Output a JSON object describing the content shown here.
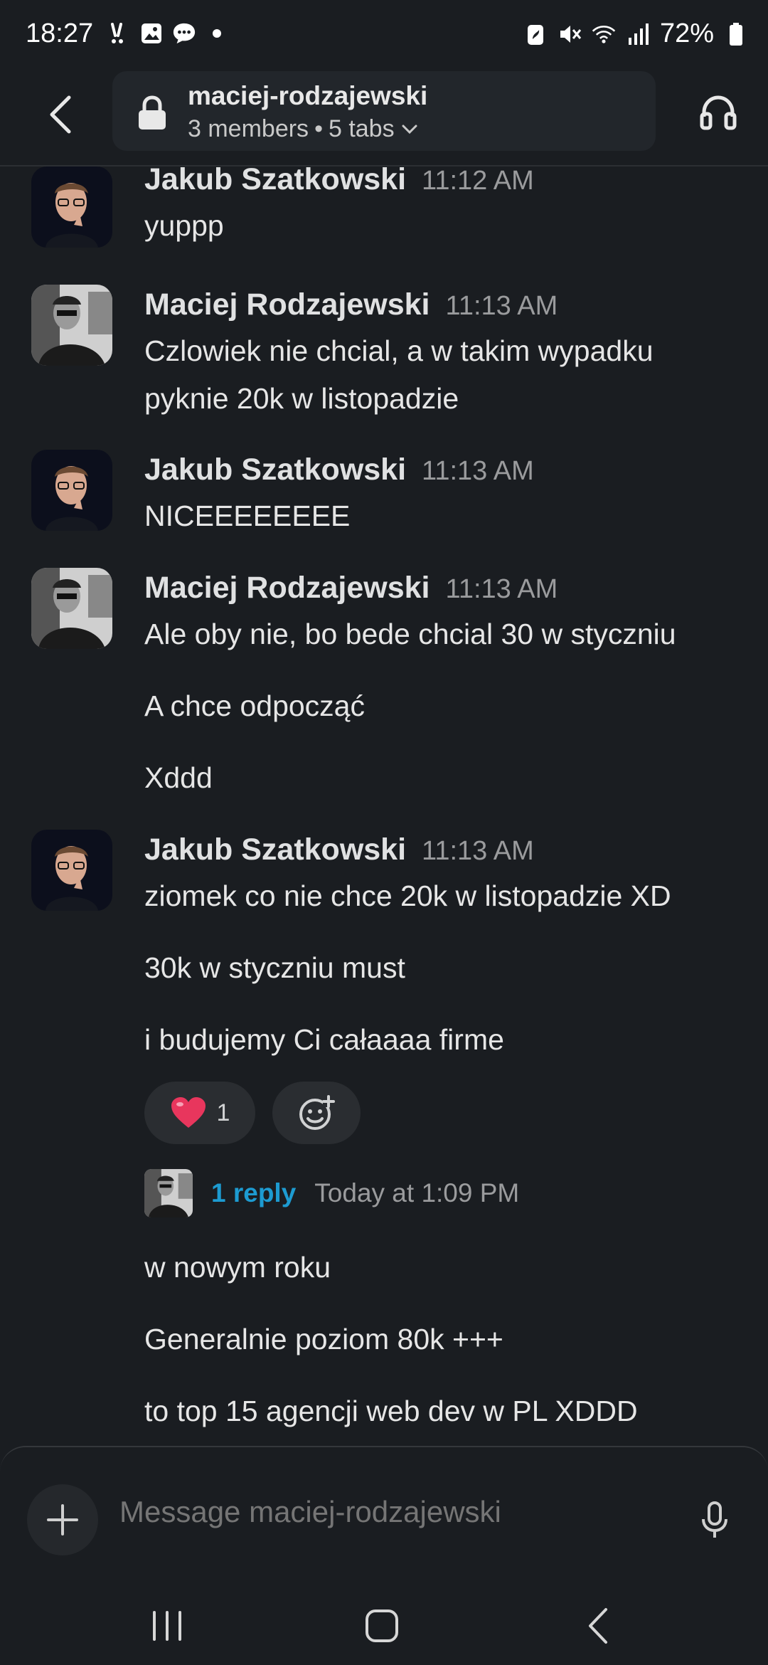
{
  "status_bar": {
    "time": "18:27",
    "battery": "72%"
  },
  "header": {
    "channel_name": "maciej-rodzajewski",
    "members": "3 members",
    "tabs": "5 tabs"
  },
  "messages": [
    {
      "author": "Jakub Szatkowski",
      "time": "11:12 AM",
      "lines": [
        "yuppp"
      ]
    },
    {
      "author": "Maciej Rodzajewski",
      "time": "11:13 AM",
      "lines": [
        "Czlowiek nie chcial, a w takim wypadku pyknie 20k w listopadzie"
      ]
    },
    {
      "author": "Jakub Szatkowski",
      "time": "11:13 AM",
      "lines": [
        "NICEEEEEEEE"
      ]
    },
    {
      "author": "Maciej Rodzajewski",
      "time": "11:13 AM",
      "lines": [
        "Ale oby nie, bo bede chcial 30 w styczniu",
        "A chce odpocząć",
        "Xddd"
      ]
    },
    {
      "author": "Jakub Szatkowski",
      "time": "11:13 AM",
      "lines": [
        "ziomek co nie chce 20k w listopadzie XD",
        "30k w styczniu must",
        "i budujemy Ci całaaaa firme"
      ]
    }
  ],
  "reaction": {
    "emoji": "heart",
    "count": "1"
  },
  "thread": {
    "reply_label": "1 reply",
    "reply_time": "Today at 1:09 PM"
  },
  "more_messages": [
    "w nowym roku",
    "Generalnie poziom 80k +++",
    "to top 15 agencji web dev w PL XDDD"
  ],
  "composer": {
    "placeholder": "Message maciej-rodzajewski"
  },
  "colors": {
    "background": "#1a1d21",
    "link": "#1d9bd1",
    "heart": "#e8365d"
  }
}
